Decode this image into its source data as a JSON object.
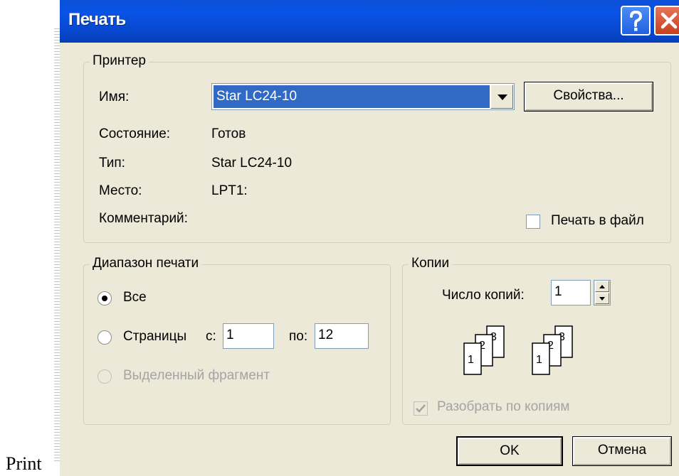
{
  "dialog": {
    "title": "Печать",
    "help_tooltip": "?",
    "close_tooltip": "X"
  },
  "page_caption": "Print",
  "printer": {
    "group_label": "Принтер",
    "name_label": "Имя:",
    "name_value": "Star LC24-10",
    "properties_button": "Свойства...",
    "status_label": "Состояние:",
    "status_value": "Готов",
    "type_label": "Тип:",
    "type_value": "Star LC24-10",
    "location_label": "Место:",
    "location_value": "LPT1:",
    "comment_label": "Комментарий:",
    "print_to_file_label": "Печать в файл",
    "print_to_file_checked": false
  },
  "range": {
    "group_label": "Диапазон печати",
    "all_label": "Все",
    "all_selected": true,
    "pages_label": "Страницы",
    "from_label": "с:",
    "from_value": "1",
    "to_label": "по:",
    "to_value": "12",
    "selection_label": "Выделенный фрагмент",
    "selection_enabled": false
  },
  "copies": {
    "group_label": "Копии",
    "count_label": "Число копий:",
    "count_value": "1",
    "collate_label": "Разобрать по копиям",
    "collate_checked": true,
    "collate_enabled": false,
    "collate_icon_pages": [
      "1",
      "2",
      "3"
    ]
  },
  "buttons": {
    "ok": "OK",
    "cancel": "Отмена"
  }
}
